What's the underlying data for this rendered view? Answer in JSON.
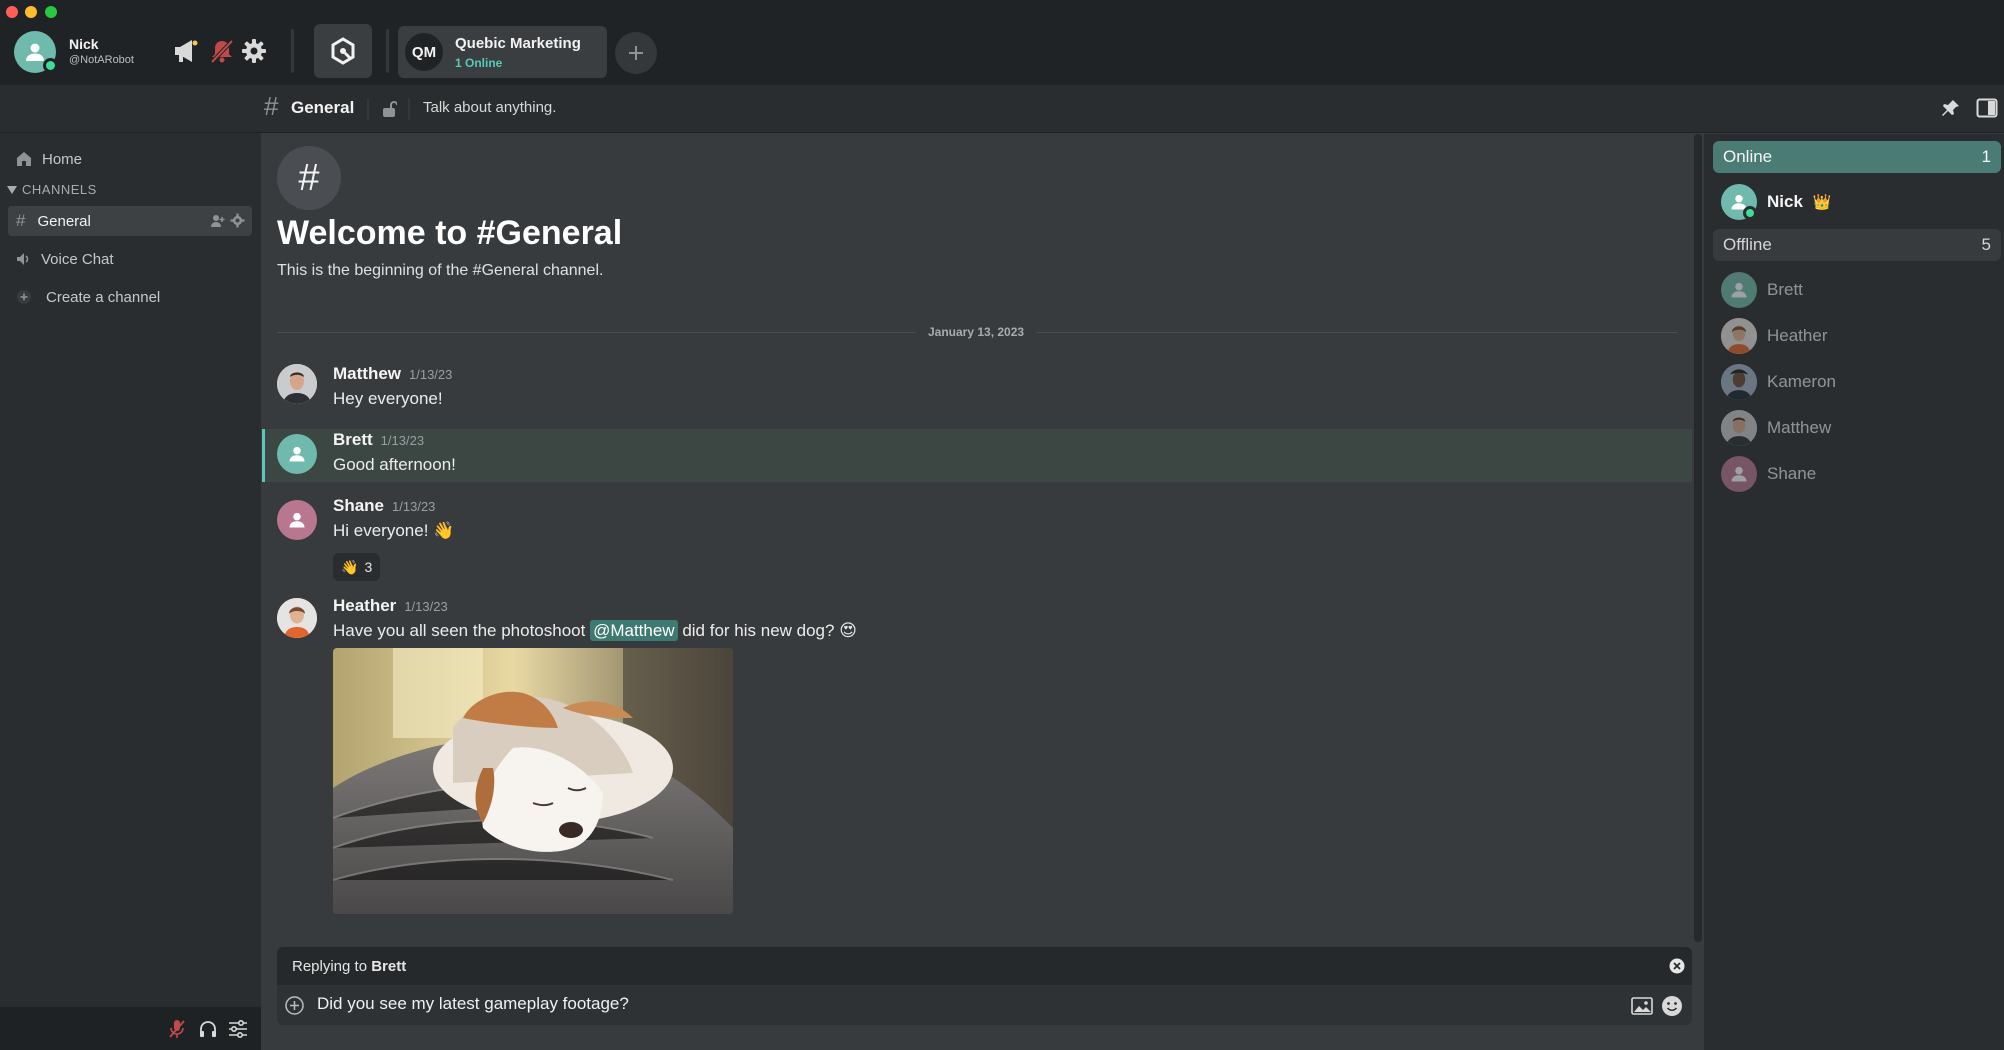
{
  "user": {
    "name": "Nick",
    "handle": "@NotARobot"
  },
  "server": {
    "initials": "QM",
    "name": "Quebic Marketing",
    "online": "1 Online"
  },
  "channel": {
    "name": "General",
    "topic": "Talk about anything."
  },
  "sidebar": {
    "home": "Home",
    "section": "CHANNELS",
    "channels": [
      {
        "label": "General",
        "kind": "text"
      },
      {
        "label": "Voice Chat",
        "kind": "voice"
      }
    ],
    "create": "Create a channel"
  },
  "welcome": {
    "title": "Welcome to #General",
    "subtitle": "This is the beginning of the #General channel."
  },
  "date_separator": "January 13, 2023",
  "messages": [
    {
      "author": "Matthew",
      "time": "1/13/23",
      "text": "Hey everyone!"
    },
    {
      "author": "Brett",
      "time": "1/13/23",
      "text": "Good afternoon!"
    },
    {
      "author": "Shane",
      "time": "1/13/23",
      "text": "Hi everyone! 👋",
      "reaction": {
        "emoji": "👋",
        "count": "3"
      }
    },
    {
      "author": "Heather",
      "time": "1/13/23",
      "text_before": "Have you all seen the photoshoot ",
      "mention": "@Matthew",
      "text_after": " did for his new dog? 😍"
    }
  ],
  "reply": {
    "prefix": "Replying to ",
    "target": "Brett"
  },
  "composer": {
    "value": "Did you see my latest gameplay footage?"
  },
  "members": {
    "online_label": "Online",
    "online_count": "1",
    "online": [
      {
        "name": "Nick",
        "badge": "👑"
      }
    ],
    "offline_label": "Offline",
    "offline_count": "5",
    "offline": [
      {
        "name": "Brett"
      },
      {
        "name": "Heather"
      },
      {
        "name": "Kameron"
      },
      {
        "name": "Matthew"
      },
      {
        "name": "Shane"
      }
    ]
  },
  "colors": {
    "accent": "#58c9b6",
    "online_header": "#4a7b74",
    "background": "#383b3e",
    "sidebar": "#2a2d30",
    "topbar": "#202325"
  }
}
